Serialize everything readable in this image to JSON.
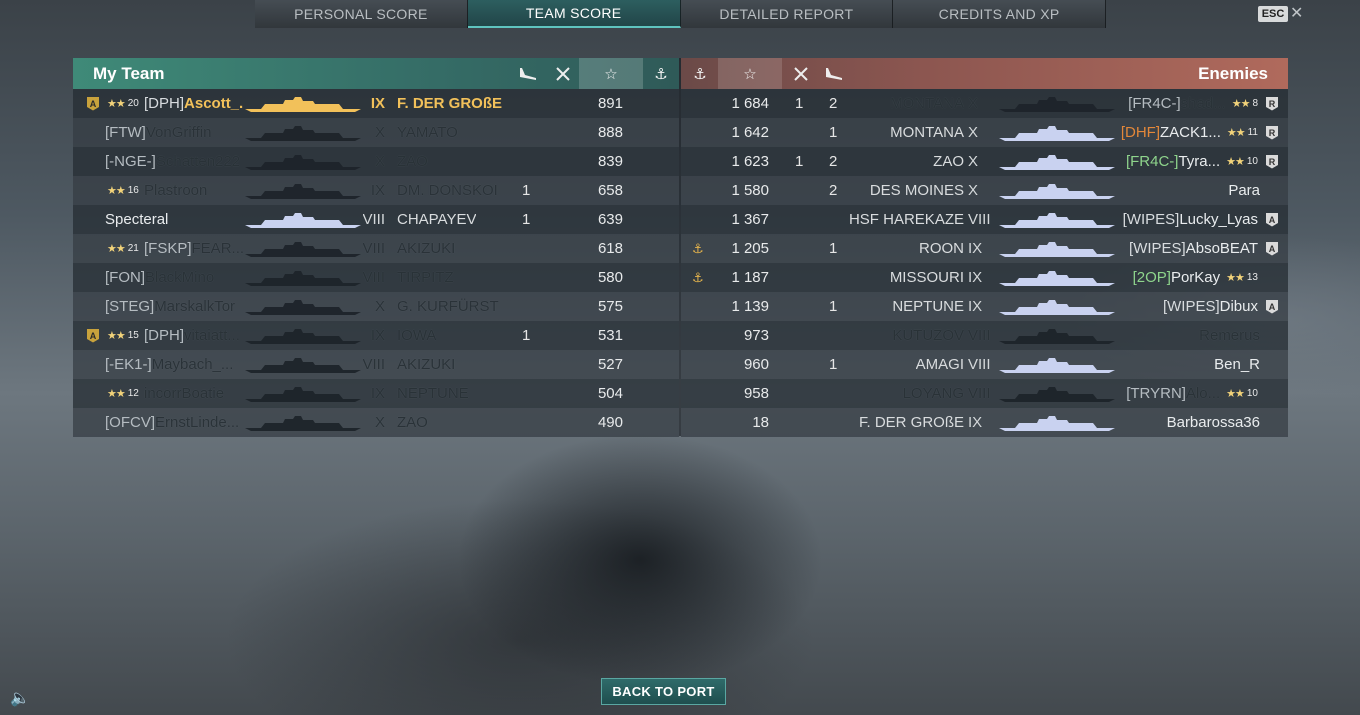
{
  "tabs": [
    {
      "label": "PERSONAL SCORE"
    },
    {
      "label": "TEAM SCORE"
    },
    {
      "label": "DETAILED REPORT"
    },
    {
      "label": "CREDITS AND XP"
    }
  ],
  "esc_label": "ESC",
  "my_team": {
    "title": "My Team",
    "rows": [
      {
        "badge": "A",
        "rank": "20",
        "clan": "[DPH]",
        "name": "Ascott_...",
        "tier": "IX",
        "ship": "F. DER GROßE",
        "kills": "",
        "score": "891",
        "highlight": true,
        "dead": false
      },
      {
        "badge": "",
        "rank": "",
        "clan": "[FTW]",
        "name": "VonGriffin",
        "tier": "X",
        "ship": "YAMATO",
        "kills": "",
        "score": "888",
        "clan_orange": true,
        "dead": true
      },
      {
        "badge": "",
        "rank": "",
        "clan": "[-NGE-]",
        "name": "Schatten222",
        "tier": "X",
        "ship": "ZAO",
        "kills": "",
        "score": "839",
        "dead": true
      },
      {
        "badge": "",
        "rank": "16",
        "clan": "",
        "name": "Plastroon",
        "tier": "IX",
        "ship": "DM. DONSKOI",
        "kills": "1",
        "score": "658",
        "dead": true
      },
      {
        "badge": "",
        "rank": "",
        "clan": "",
        "name": "Specteral",
        "tier": "VIII",
        "ship": "CHAPAYEV",
        "kills": "1",
        "score": "639",
        "dead": false
      },
      {
        "badge": "",
        "rank": "21",
        "clan": "[FSKP]",
        "name": "FEAR...",
        "tier": "VIII",
        "ship": "AKIZUKI",
        "kills": "",
        "score": "618",
        "dead": true
      },
      {
        "badge": "",
        "rank": "",
        "clan": "[FON]",
        "name": "BlackMino",
        "tier": "VIII",
        "ship": "TIRPITZ",
        "kills": "",
        "score": "580",
        "dead": true
      },
      {
        "badge": "",
        "rank": "",
        "clan": "[STEG]",
        "name": "MarskalkTor",
        "tier": "X",
        "ship": "G. KURFÜRST",
        "kills": "",
        "score": "575",
        "dead": true
      },
      {
        "badge": "A",
        "rank": "15",
        "clan": "[DPH]",
        "name": "vitaiatt...",
        "tier": "IX",
        "ship": "IOWA",
        "kills": "1",
        "score": "531",
        "dead": true
      },
      {
        "badge": "",
        "rank": "",
        "clan": "[-EK1-]",
        "name": "Maybach_...",
        "tier": "VIII",
        "ship": "AKIZUKI",
        "kills": "",
        "score": "527",
        "dead": true
      },
      {
        "badge": "",
        "rank": "12",
        "clan": "",
        "name": "incorrBoatie",
        "tier": "IX",
        "ship": "NEPTUNE",
        "kills": "",
        "score": "504",
        "dead": true
      },
      {
        "badge": "",
        "rank": "",
        "clan": "[OFCV]",
        "name": "ErnstLinde...",
        "tier": "X",
        "ship": "ZAO",
        "kills": "",
        "score": "490",
        "dead": true
      }
    ]
  },
  "enemies": {
    "title": "Enemies",
    "rows": [
      {
        "anchor": false,
        "score": "1 684",
        "k1": "1",
        "k2": "2",
        "ship": "MONTANA",
        "tier": "X",
        "clan": "[FR4C-]",
        "name": "shad...",
        "rank": "8",
        "badge": "R",
        "clan_green": true,
        "dead": true
      },
      {
        "anchor": false,
        "score": "1 642",
        "k1": "",
        "k2": "1",
        "ship": "MONTANA",
        "tier": "X",
        "clan": "[DHF]",
        "name": "ZACK1...",
        "rank": "11",
        "badge": "R",
        "clan_orange": true,
        "dead": false
      },
      {
        "anchor": false,
        "score": "1 623",
        "k1": "1",
        "k2": "2",
        "ship": "ZAO",
        "tier": "X",
        "clan": "[FR4C-]",
        "name": "Tyra...",
        "rank": "10",
        "badge": "R",
        "clan_green": true,
        "dead": false
      },
      {
        "anchor": false,
        "score": "1 580",
        "k1": "",
        "k2": "2",
        "ship": "DES MOINES",
        "tier": "X",
        "clan": "",
        "name": "Para",
        "rank": "",
        "badge": "",
        "dead": false
      },
      {
        "anchor": false,
        "score": "1 367",
        "k1": "",
        "k2": "",
        "ship": "HSF HAREKAZE",
        "tier": "VIII",
        "clan": "[WIPES]",
        "name": "Lucky_Lyas",
        "rank": "",
        "badge": "A",
        "dead": false
      },
      {
        "anchor": true,
        "score": "1 205",
        "k1": "",
        "k2": "1",
        "ship": "ROON",
        "tier": "IX",
        "clan": "[WIPES]",
        "name": "AbsoBEAT",
        "rank": "",
        "badge": "A",
        "dead": false
      },
      {
        "anchor": true,
        "score": "1 187",
        "k1": "",
        "k2": "",
        "ship": "MISSOURI",
        "tier": "IX",
        "clan": "[2OP]",
        "name": "PorKay",
        "rank": "13",
        "badge": "",
        "clan_green": true,
        "dead": false
      },
      {
        "anchor": false,
        "score": "1 139",
        "k1": "",
        "k2": "1",
        "ship": "NEPTUNE",
        "tier": "IX",
        "clan": "[WIPES]",
        "name": "Dibux",
        "rank": "",
        "badge": "A",
        "dead": false
      },
      {
        "anchor": false,
        "score": "973",
        "k1": "",
        "k2": "",
        "ship": "KUTUZOV",
        "tier": "VIII",
        "clan": "",
        "name": "Remerus",
        "rank": "",
        "badge": "",
        "dead": true
      },
      {
        "anchor": false,
        "score": "960",
        "k1": "",
        "k2": "1",
        "ship": "AMAGI",
        "tier": "VIII",
        "clan": "",
        "name": "Ben_R",
        "rank": "",
        "badge": "",
        "dead": false
      },
      {
        "anchor": false,
        "score": "958",
        "k1": "",
        "k2": "",
        "ship": "LOYANG",
        "tier": "VIII",
        "clan": "[TRYRN]",
        "name": "Alo...",
        "rank": "10",
        "badge": "",
        "dead": true
      },
      {
        "anchor": false,
        "score": "18",
        "k1": "",
        "k2": "",
        "ship": "F. DER GROßE",
        "tier": "IX",
        "clan": "",
        "name": "Barbarossa36",
        "rank": "",
        "badge": "",
        "dead": false
      }
    ]
  },
  "back_button": "BACK TO PORT",
  "colors": {
    "highlight": "#f2c15a",
    "my_team_header": "#3f8a78",
    "enemy_header": "#b06a5c",
    "back_button": "#2f6b6a"
  }
}
